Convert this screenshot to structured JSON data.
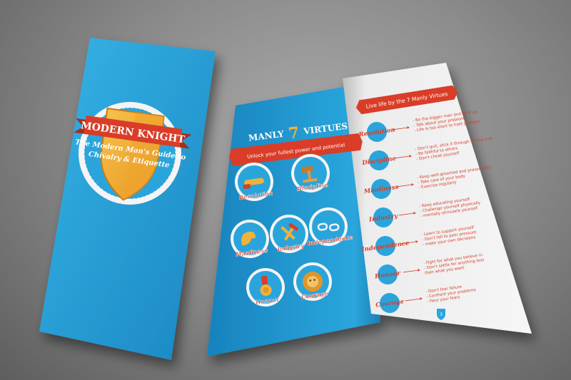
{
  "cover": {
    "title": "MODERN KNIGHT",
    "subtitle_line1": "The Modern Man's Guide to",
    "subtitle_line2": "Chivalry & Etiquette"
  },
  "inside_left": {
    "heading_prefix": "MANLY",
    "heading_number": "7",
    "heading_suffix": "VIRTUES",
    "tagline": "Unlock your fullest power and potential",
    "badges": [
      {
        "label": "Resolution",
        "icon": "handshake-icon"
      },
      {
        "label": "Discipline",
        "icon": "gavel-icon"
      },
      {
        "label": "Manliness",
        "icon": "flexed-arm-icon"
      },
      {
        "label": "Industry",
        "icon": "crossed-tools-icon"
      },
      {
        "label": "Independence",
        "icon": "broken-chain-icon"
      },
      {
        "label": "Honour",
        "icon": "medal-icon"
      },
      {
        "label": "Courage",
        "icon": "lion-icon"
      }
    ]
  },
  "inside_right": {
    "ribbon": "Live life by the 7 Manly Virtues",
    "page_number": "3",
    "virtues": [
      {
        "name": "Resolution",
        "points": [
          "- Be the bigger man and let it go",
          "- Talk about your problems",
          "- Life is too short to hold grudges"
        ]
      },
      {
        "name": "Discipline",
        "points": [
          "- Don't quit, stick it through till the end",
          "- Be faithful to others",
          "- Don't cheat yourself"
        ]
      },
      {
        "name": "Manliness",
        "points": [
          "- Keep well-groomed and presentable",
          "- Take care of your body",
          "- Exercise regularly"
        ]
      },
      {
        "name": "Industry",
        "points": [
          "- Keep educating yourself",
          "- Challenge yourself physically",
          "- mentally stimulate yourself"
        ]
      },
      {
        "name": "Independence",
        "points": [
          "- Learn to support yourself",
          "- Don't fall to peer pressure",
          "- make your own decisions"
        ]
      },
      {
        "name": "Honour",
        "points": [
          "- Fight for what you believe in",
          "- Don't settle for anything less",
          "than what you want"
        ]
      },
      {
        "name": "Courage",
        "points": [
          "- Don't fear failure",
          "- Confront your problems",
          "- Face your fears"
        ]
      }
    ]
  },
  "colors": {
    "blue": "#1f9fd8",
    "red": "#d93d28",
    "gold": "#f0b23a",
    "paper": "#efefef"
  }
}
